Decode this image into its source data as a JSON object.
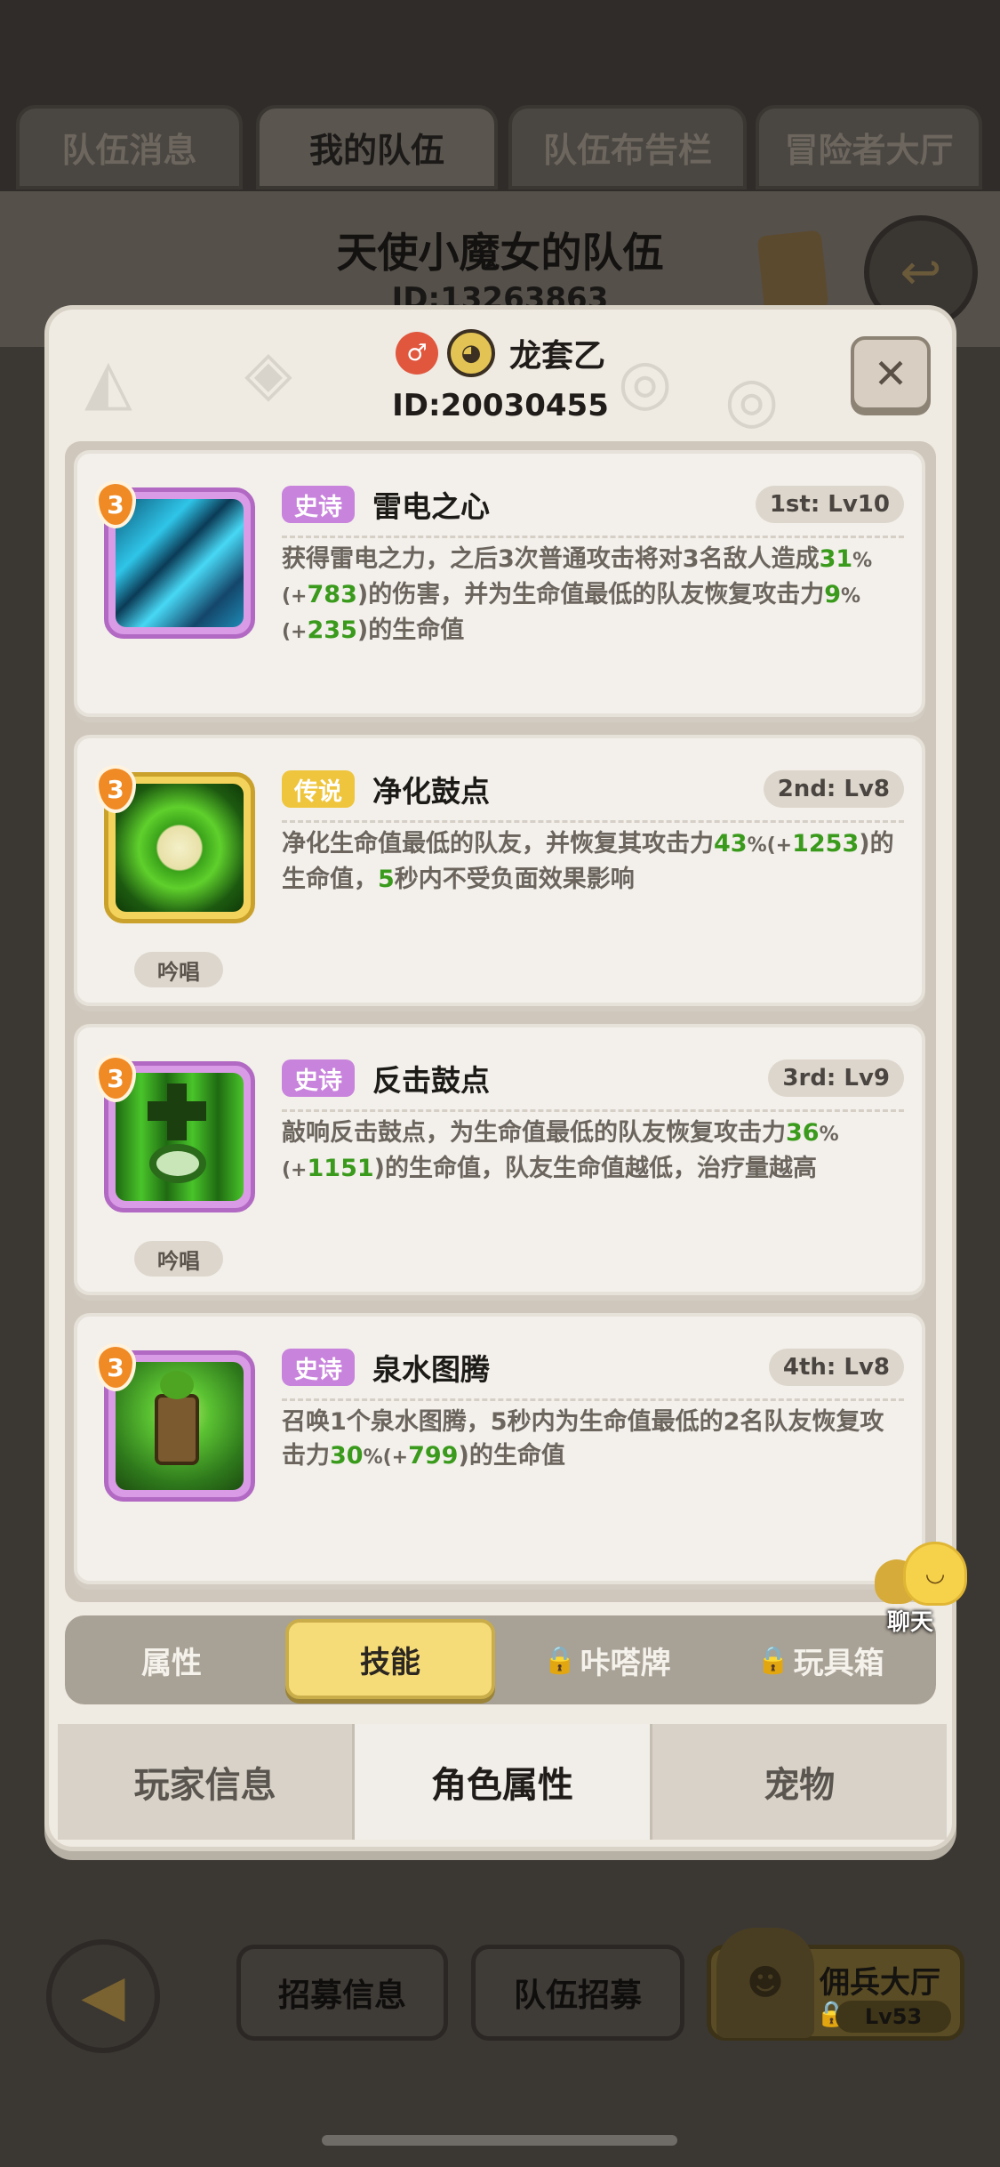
{
  "background": {
    "tabs": [
      "队伍消息",
      "我的队伍",
      "队伍布告栏",
      "冒险者大厅"
    ],
    "active_tab": 1,
    "team_name": "天使小魔女的队伍",
    "team_id": "ID:13263863"
  },
  "character": {
    "name": "龙套乙",
    "id": "ID:20030455"
  },
  "skills": [
    {
      "rarity": "史诗",
      "rarity_level": "epic",
      "name": "雷电之心",
      "slot": "1st: Lv10",
      "level_badge": "3",
      "desc_parts": [
        "获得雷电之力，之后3次普通攻击将对3名敌人造成",
        "31",
        "%(+",
        "783",
        ")的伤害，并为生命值最低的队友恢复攻击力",
        "9",
        "%(+",
        "235",
        ")的生命值"
      ],
      "chant": ""
    },
    {
      "rarity": "传说",
      "rarity_level": "legend",
      "name": "净化鼓点",
      "slot": "2nd: Lv8",
      "level_badge": "3",
      "desc_parts": [
        "净化生命值最低的队友，并恢复其攻击力",
        "43",
        "%(+",
        "1253",
        ")的生命值，",
        "5",
        "秒内不受负面效果影响"
      ],
      "chant": "吟唱"
    },
    {
      "rarity": "史诗",
      "rarity_level": "epic",
      "name": "反击鼓点",
      "slot": "3rd: Lv9",
      "level_badge": "3",
      "desc_parts": [
        "敲响反击鼓点，为生命值最低的队友恢复攻击力",
        "36",
        "%(+",
        "1151",
        ")的生命值，队友生命值越低，治疗量越高"
      ],
      "chant": "吟唱"
    },
    {
      "rarity": "史诗",
      "rarity_level": "epic",
      "name": "泉水图腾",
      "slot": "4th: Lv8",
      "level_badge": "3",
      "desc_parts": [
        "召唤1个泉水图腾，5秒内为生命值最低的2名队友恢复攻击力",
        "30",
        "%(+",
        "799",
        ")的生命值"
      ],
      "chant": ""
    }
  ],
  "sub_tabs": [
    "属性",
    "技能",
    "咔嗒牌",
    "玩具箱"
  ],
  "sub_tab_active": 1,
  "modal_tabs": [
    "玩家信息",
    "角色属性",
    "宠物"
  ],
  "modal_tab_active": 1,
  "chat_label": "聊天",
  "bottom_bar": {
    "recruit_info": "招募信息",
    "team_recruit": "队伍招募",
    "merc_hall": "佣兵大厅",
    "merc_level": "Lv53"
  },
  "colors": {
    "epic": "#c883dc",
    "legend": "#efc53d",
    "highlight_value": "#3a9a1c",
    "active_tab": "#f6dc79"
  },
  "icons": [
    "title-badge-icon",
    "character-avatar-icon",
    "close-icon",
    "lock-icon",
    "back-arrow-icon",
    "chat-icon",
    "scroll-icon"
  ]
}
